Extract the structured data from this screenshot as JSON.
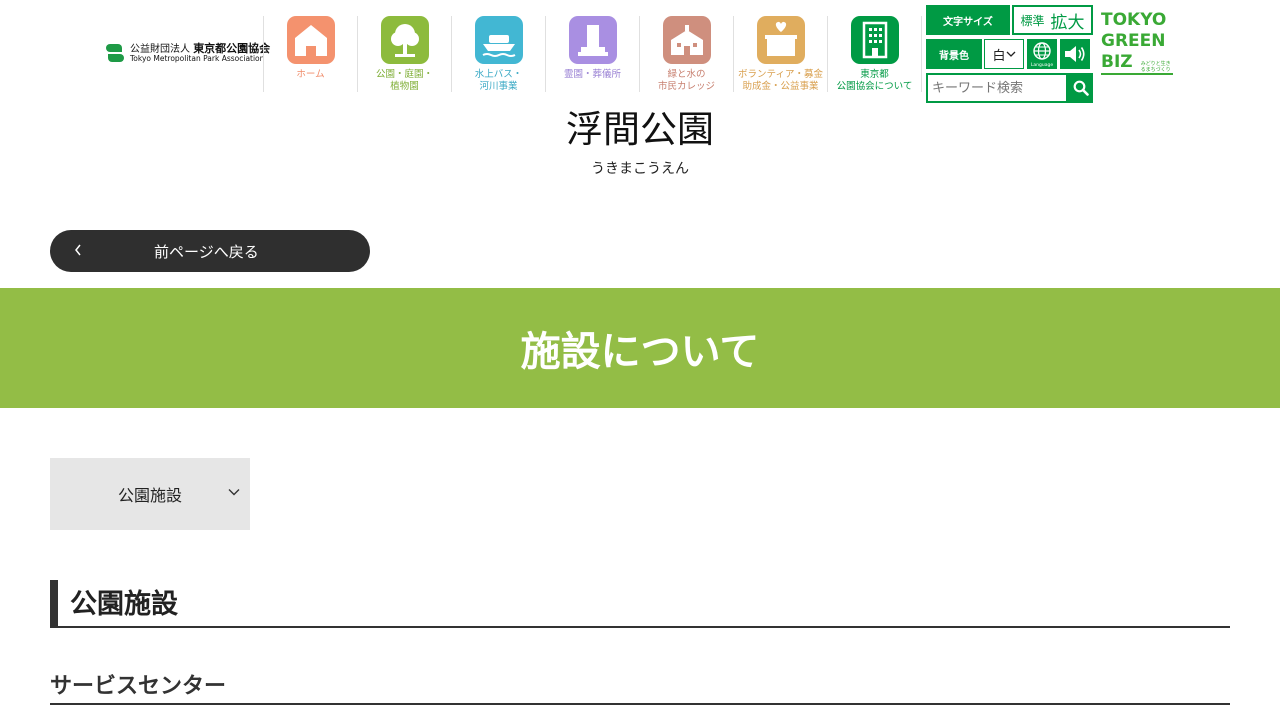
{
  "logo": {
    "line1_small": "公益財団法人",
    "line1_main": "東京都公園協会",
    "line2": "Tokyo Metropolitan Park Association"
  },
  "nav": [
    {
      "label": "ホーム",
      "icon": "home-icon",
      "color": "#f4926e",
      "label_color": "#f08c6a"
    },
    {
      "label": "公園・庭園・\n植物園",
      "icon": "tree-icon",
      "color": "#8dbb3d",
      "label_color": "#7fae37"
    },
    {
      "label": "水上バス・\n河川事業",
      "icon": "boat-icon",
      "color": "#42b7d3",
      "label_color": "#3aa9c5"
    },
    {
      "label": "霊園・葬儀所",
      "icon": "grave-icon",
      "color": "#a98fe2",
      "label_color": "#9a82d4"
    },
    {
      "label": "緑と水の\n市民カレッジ",
      "icon": "school-icon",
      "color": "#cf8f7e",
      "label_color": "#c88070"
    },
    {
      "label": "ボランティア・募金\n助成金・公益事業",
      "icon": "donation-box-icon",
      "color": "#e0ad5e",
      "label_color": "#d9a04f"
    },
    {
      "label": "東京都\n公園協会について",
      "icon": "building-icon",
      "color": "#009a44",
      "label_color": "#009a44"
    }
  ],
  "tools": {
    "font_size_label": "文字サイズ",
    "font_standard": "標準",
    "font_large": "拡大",
    "bg_color_label": "背景色",
    "bg_color_value": "白",
    "language_label": "Language",
    "search_placeholder": "キーワード検索"
  },
  "green_biz": {
    "line1": "TOKYO",
    "line2": "GREEN",
    "line3": "BIZ",
    "sub": "みどりと生きるまちづくり"
  },
  "page": {
    "title": "浮間公園",
    "kana": "うきまこうえん",
    "back_label": "前ページへ戻る",
    "band_title": "施設について",
    "dropdown_value": "公園施設",
    "section_title": "公園施設",
    "subsection_title": "サービスセンター"
  },
  "colors": {
    "accent_green": "#009a44",
    "band_green": "#93bd46",
    "dark": "#2f2f2f"
  }
}
